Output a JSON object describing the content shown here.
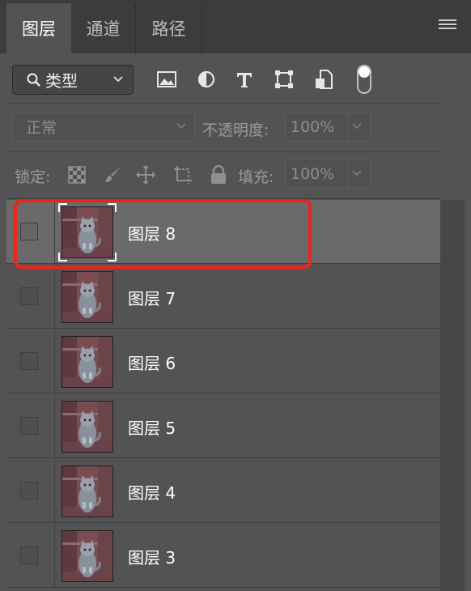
{
  "tabs": [
    {
      "label": "图层",
      "active": true
    },
    {
      "label": "通道",
      "active": false
    },
    {
      "label": "路径",
      "active": false
    }
  ],
  "filter": {
    "kind_label": "类型",
    "icons": [
      "image-filter-icon",
      "adjustment-filter-icon",
      "type-filter-icon",
      "shape-filter-icon",
      "smart-object-filter-icon"
    ],
    "toggle_on": true
  },
  "blend": {
    "mode": "正常",
    "opacity_label": "不透明度:",
    "opacity_value": "100%"
  },
  "lock": {
    "label": "锁定:",
    "icons": [
      "lock-transparent-icon",
      "lock-image-icon",
      "lock-position-icon",
      "lock-artboard-icon",
      "lock-all-icon"
    ],
    "fill_label": "填充:",
    "fill_value": "100%"
  },
  "layers": [
    {
      "name": "图层 8",
      "selected": true
    },
    {
      "name": "图层 7",
      "selected": false
    },
    {
      "name": "图层 6",
      "selected": false
    },
    {
      "name": "图层 5",
      "selected": false
    },
    {
      "name": "图层 4",
      "selected": false
    },
    {
      "name": "图层 3",
      "selected": false
    }
  ],
  "colors": {
    "panel_bg": "#535353",
    "tab_bar_bg": "#3c3c3c",
    "selected_row": "#6a6a6a",
    "highlight_annotation": "#e8261d"
  }
}
